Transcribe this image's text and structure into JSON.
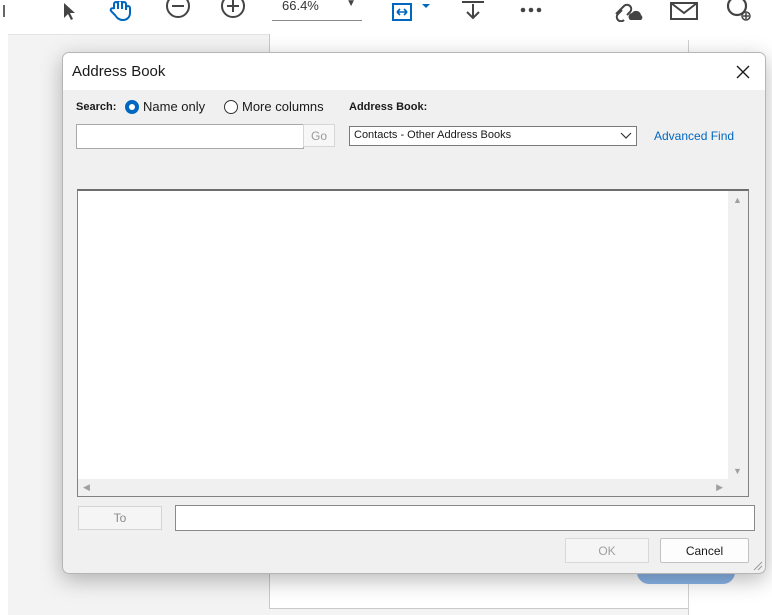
{
  "toolbar": {
    "zoom": "66.4%",
    "icons": [
      "select-pointer-icon",
      "hand-pan-icon",
      "zoom-out-icon",
      "zoom-in-icon",
      "fit-page-icon",
      "download-icon",
      "more-icon",
      "link-cloud-icon",
      "mail-icon",
      "add-user-icon"
    ]
  },
  "dialog": {
    "title": "Address Book",
    "search_label": "Search:",
    "radio_name_only": "Name only",
    "radio_more_columns": "More columns",
    "search_value": "",
    "go_label": "Go",
    "address_book_label": "Address Book:",
    "address_book_selected": "Contacts - Other Address Books",
    "advanced_find": "Advanced Find",
    "to_label": "To",
    "to_value": "",
    "ok_label": "OK",
    "cancel_label": "Cancel"
  },
  "colors": {
    "accent": "#0067c0",
    "dialog_bg": "#f0f0f0"
  }
}
